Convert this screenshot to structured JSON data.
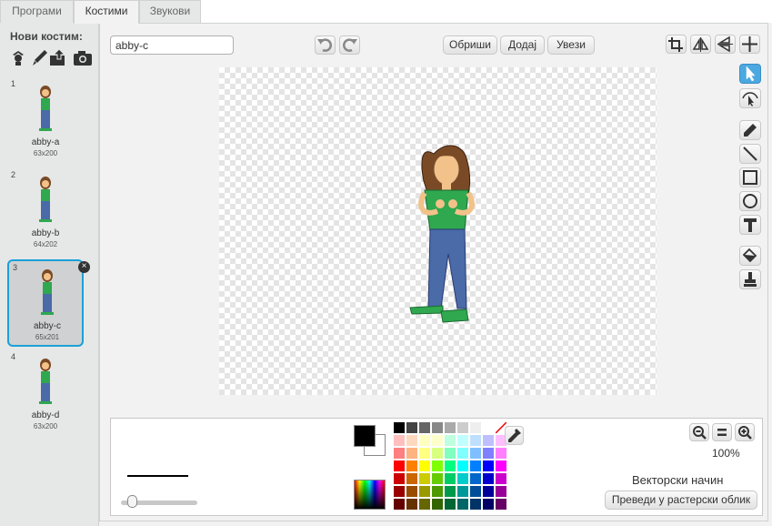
{
  "tabs": [
    {
      "label": "Програми"
    },
    {
      "label": "Костими"
    },
    {
      "label": "Звукови"
    }
  ],
  "sidebar": {
    "title": "Нови костим:",
    "new_icons": [
      "sprite-library-icon",
      "paint-brush-icon",
      "upload-icon",
      "camera-icon"
    ],
    "costumes": [
      {
        "number": "1",
        "name": "abby-a",
        "size": "63x200"
      },
      {
        "number": "2",
        "name": "abby-b",
        "size": "64x202"
      },
      {
        "number": "3",
        "name": "abby-c",
        "size": "65x201",
        "selected": true
      },
      {
        "number": "4",
        "name": "abby-d",
        "size": "63x200"
      }
    ],
    "delete_glyph": "×"
  },
  "editor": {
    "costume_name": "abby-c",
    "clear_label": "Обриши",
    "add_label": "Додај",
    "import_label": "Увези",
    "zoom_level": "100%",
    "mode_label": "Векторски начин",
    "convert_label": "Преведи у растерски облик",
    "colors": {
      "accent": "#1aa0d8",
      "selected_tool": "#4ba8e0",
      "foreground": "#000000",
      "background": "#ffffff"
    }
  }
}
